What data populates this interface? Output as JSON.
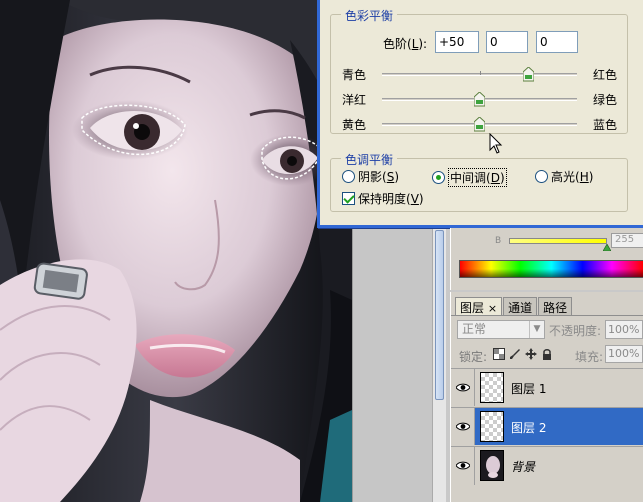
{
  "dialog": {
    "color_balance_group": "色彩平衡",
    "levels_label": "色阶(L):",
    "levels_label_parts": [
      "色阶(",
      "L",
      "):"
    ],
    "levels": [
      "+50",
      "0",
      "0"
    ],
    "sliders": [
      {
        "left": "青色",
        "right": "红色",
        "value": 50
      },
      {
        "left": "洋红",
        "right": "绿色",
        "value": 0
      },
      {
        "left": "黄色",
        "right": "蓝色",
        "value": 0
      }
    ],
    "tone_balance_group": "色调平衡",
    "tones": [
      {
        "label": "阴影",
        "key": "S",
        "selected": false
      },
      {
        "label": "中间调",
        "key": "D",
        "selected": true
      },
      {
        "label": "高光",
        "key": "H",
        "selected": false
      }
    ],
    "preserve_luminosity": {
      "label": "保持明度",
      "key": "V",
      "checked": true
    }
  },
  "color_panel": {
    "channel_label": "B",
    "value": "255"
  },
  "layers_panel": {
    "tabs": [
      "图层",
      "通道",
      "路径"
    ],
    "close_glyph": "×",
    "blend_mode": "正常",
    "opacity_label": "不透明度:",
    "opacity_value": "100%",
    "lock_label": "锁定:",
    "fill_label": "填充:",
    "fill_value": "100%",
    "layers": [
      {
        "name": "图层 1",
        "selected": false,
        "visible": true
      },
      {
        "name": "图层 2",
        "selected": true,
        "visible": true
      },
      {
        "name": "背景",
        "selected": false,
        "visible": true
      }
    ]
  },
  "icons": [
    "eye-icon",
    "lock-transparent-icon",
    "lock-brush-icon",
    "lock-move-icon",
    "lock-all-icon",
    "mouse-cursor-icon"
  ],
  "colors": {
    "accent": "#316ac5",
    "legend_text": "#1d3fa6",
    "dialog_bg": "#ece9d8"
  }
}
